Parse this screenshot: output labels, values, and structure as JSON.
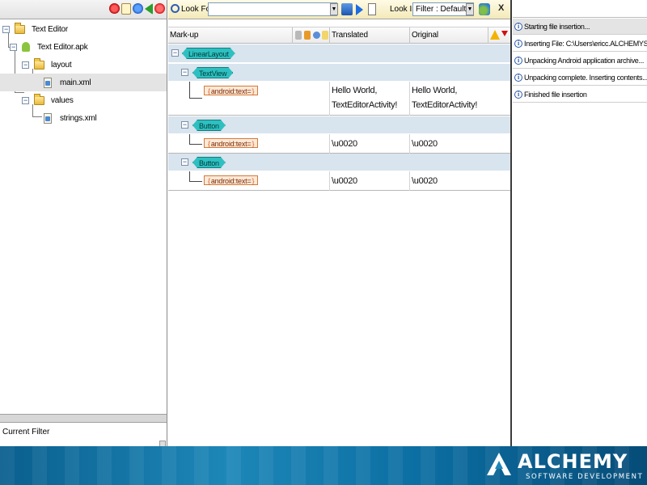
{
  "left_pane": {
    "toolbar_icons": [
      "stop-icon",
      "page-icon",
      "info-icon",
      "back-icon",
      "close-icon"
    ],
    "tree": [
      {
        "label": "Text Editor",
        "icon": "folder-icon"
      },
      {
        "label": "Text Editor.apk",
        "icon": "android-icon"
      },
      {
        "label": "layout",
        "icon": "folder-icon"
      },
      {
        "label": "main.xml",
        "icon": "xml-file-icon",
        "selected": true
      },
      {
        "label": "values",
        "icon": "folder-icon"
      },
      {
        "label": "strings.xml",
        "icon": "xml-file-icon"
      }
    ],
    "filter_label": "Current Filter"
  },
  "toolbar": {
    "look_for_label": "Look For:",
    "look_for_value": "",
    "look_in_label": "Look In:",
    "filter_value": "Filter : Default",
    "close_label": "X"
  },
  "grid": {
    "columns": {
      "markup": "Mark-up",
      "translated": "Translated",
      "original": "Original"
    },
    "rows": [
      {
        "kind": "node",
        "tag": "LinearLayout"
      },
      {
        "kind": "node",
        "tag": "TextView"
      },
      {
        "kind": "attr",
        "attr": "android:text=",
        "translated_1": "Hello World,",
        "translated_2": "TextEditorActivity!",
        "original_1": "Hello World,",
        "original_2": "TextEditorActivity!"
      },
      {
        "kind": "node",
        "tag": "Button"
      },
      {
        "kind": "attr",
        "attr": "android:text=",
        "translated": "\\u0020",
        "original": "\\u0020"
      },
      {
        "kind": "node",
        "tag": "Button"
      },
      {
        "kind": "attr",
        "attr": "android:text=",
        "translated": "\\u0020",
        "original": "\\u0020"
      }
    ]
  },
  "log": [
    "Starting file insertion...",
    "Inserting File:  C:\\Users\\ericc.ALCHEMYSOFTW...",
    "Unpacking Android application archive...",
    "Unpacking complete. Inserting contents...",
    "Finished file insertion"
  ],
  "banner": {
    "logo_word": "ALCHEMY",
    "logo_sub": "SOFTWARE  DEVELOPMENT"
  },
  "colors": {
    "node_row": "#d8e4ee",
    "tag_fill": "#2ec0c0",
    "attr_fill": "#ffe9d8",
    "banner": "#1d87b8"
  }
}
